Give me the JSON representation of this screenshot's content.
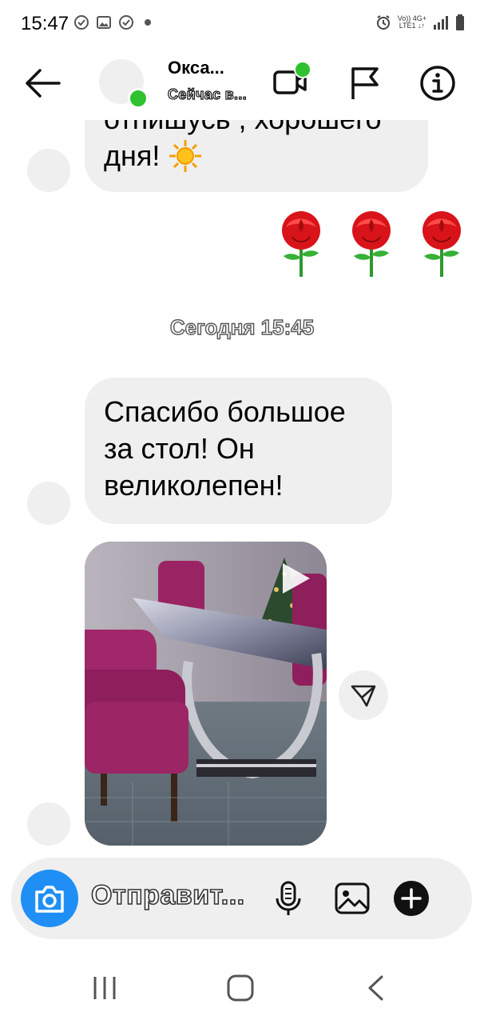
{
  "status_bar": {
    "time": "15:47",
    "network_top": "Vo)) 4G+",
    "network_bottom": "LTE1 ↓↑",
    "icons": [
      "check-circle-icon",
      "gallery-icon",
      "check-circle-icon",
      "dot-icon",
      "alarm-icon",
      "signal-icon",
      "battery-icon"
    ]
  },
  "header": {
    "contact_name": "Окса...",
    "contact_status": "Сейчас в...",
    "online_color": "#2fc12f"
  },
  "messages": {
    "cut_off_line": "отпишусь , хорошего",
    "prev_message_end": "дня! ",
    "sun_emoji": "☀",
    "roses": [
      "🌹",
      "🌹",
      "🌹"
    ],
    "timestamp": "Сегодня 15:45",
    "thanks_line1": "Спасибо большое",
    "thanks_line2": "за стол! Он",
    "thanks_line3": "великолепен!"
  },
  "composer": {
    "placeholder": "Отправит...",
    "accent": "#1f8ff5"
  },
  "navbar": {
    "icons": [
      "recent-apps-icon",
      "home-icon",
      "back-nav-icon"
    ]
  }
}
